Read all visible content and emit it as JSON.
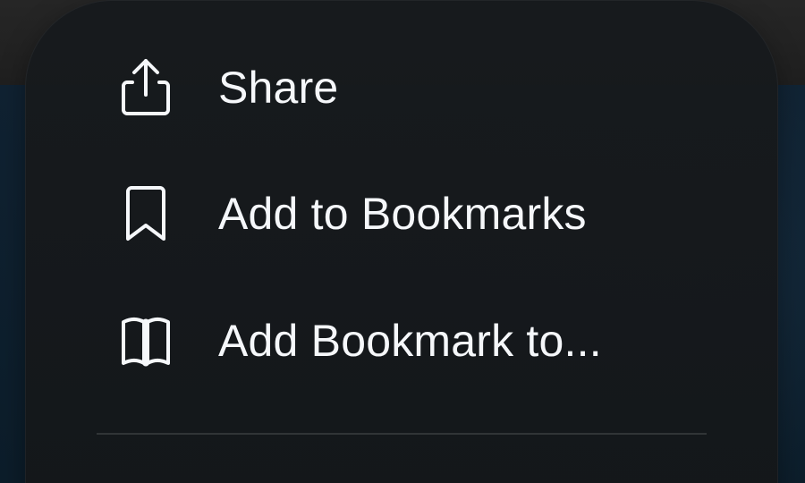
{
  "menu": {
    "items": [
      {
        "label": "Share",
        "icon": "share-icon"
      },
      {
        "label": "Add to Bookmarks",
        "icon": "bookmark-icon"
      },
      {
        "label": "Add Bookmark to...",
        "icon": "book-icon"
      }
    ]
  },
  "colors": {
    "menu_background": "#171a1d",
    "text": "#f5f7fa",
    "divider": "#2f3337",
    "background": "#102232"
  }
}
